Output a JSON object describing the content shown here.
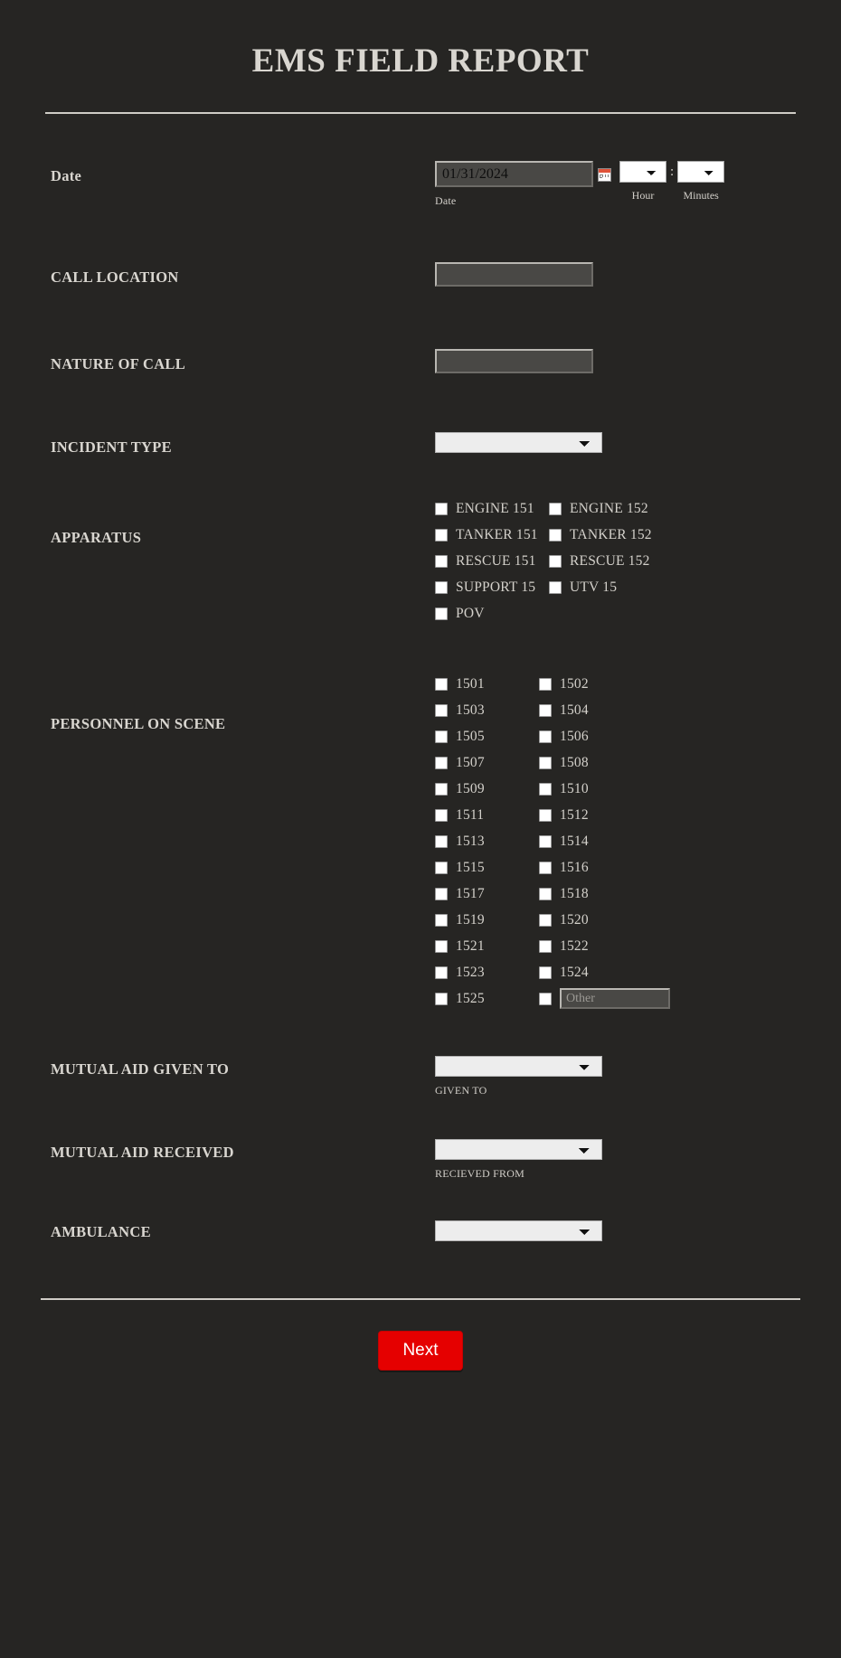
{
  "page": {
    "title": "EMS FIELD REPORT",
    "background_color": "#262523",
    "accent_color": "#e50000"
  },
  "fields": {
    "date": {
      "label": "Date",
      "value": "01/31/2024",
      "caption": "Date",
      "calendar_icon": "calendar-icon",
      "hour": {
        "value": "",
        "caption": "Hour"
      },
      "separator": ":",
      "minutes": {
        "value": "",
        "caption": "Minutes"
      }
    },
    "call_location": {
      "label": "CALL LOCATION",
      "value": "",
      "placeholder": ""
    },
    "nature_of_call": {
      "label": "NATURE OF CALL",
      "value": "",
      "placeholder": ""
    },
    "incident_type": {
      "label": "INCIDENT TYPE",
      "value": ""
    },
    "apparatus": {
      "label": "APPARATUS",
      "rows": [
        {
          "left": "ENGINE 151",
          "right": "ENGINE 152"
        },
        {
          "left": "TANKER 151",
          "right": "TANKER 152"
        },
        {
          "left": "RESCUE 151",
          "right": "RESCUE 152"
        },
        {
          "left": "SUPPORT 15",
          "right": "UTV 15"
        },
        {
          "left": "POV",
          "right": ""
        }
      ]
    },
    "personnel": {
      "label": "PERSONNEL ON SCENE",
      "rows": [
        {
          "left": "1501",
          "right": "1502"
        },
        {
          "left": "1503",
          "right": "1504"
        },
        {
          "left": "1505",
          "right": "1506"
        },
        {
          "left": "1507",
          "right": "1508"
        },
        {
          "left": "1509",
          "right": "1510"
        },
        {
          "left": "1511",
          "right": "1512"
        },
        {
          "left": "1513",
          "right": "1514"
        },
        {
          "left": "1515",
          "right": "1516"
        },
        {
          "left": "1517",
          "right": "1518"
        },
        {
          "left": "1519",
          "right": "1520"
        },
        {
          "left": "1521",
          "right": "1522"
        },
        {
          "left": "1523",
          "right": "1524"
        }
      ],
      "last_row": {
        "left": "1525",
        "other_placeholder": "Other",
        "other_value": ""
      }
    },
    "mutual_aid_given": {
      "label": "MUTUAL AID GIVEN TO",
      "value": "",
      "caption": "GIVEN TO"
    },
    "mutual_aid_received": {
      "label": "MUTUAL AID RECEIVED",
      "value": "",
      "caption": "RECIEVED FROM"
    },
    "ambulance": {
      "label": "AMBULANCE",
      "value": ""
    }
  },
  "footer": {
    "next_label": "Next"
  }
}
